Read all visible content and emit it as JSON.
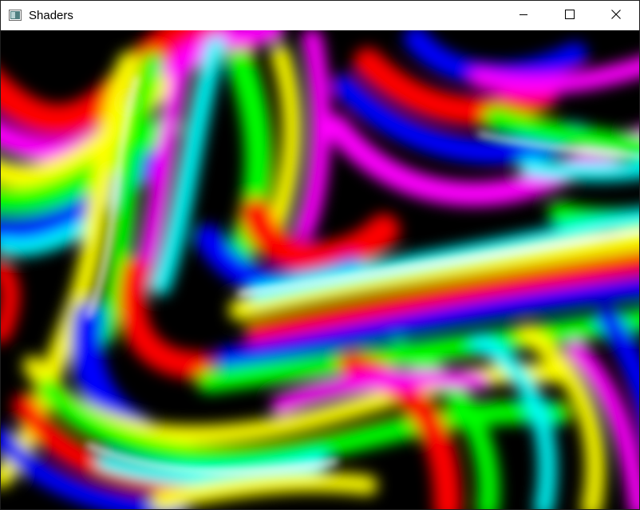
{
  "window": {
    "title": "Shaders",
    "icon": "window-app-icon",
    "controls": {
      "minimize": "minimize-icon",
      "maximize": "maximize-icon",
      "close": "close-icon"
    }
  },
  "render": {
    "palette": [
      "#ff0000",
      "#ffff00",
      "#00ff00",
      "#00ffff",
      "#0000ff",
      "#ff00ff",
      "#ffffff",
      "#000000"
    ]
  }
}
